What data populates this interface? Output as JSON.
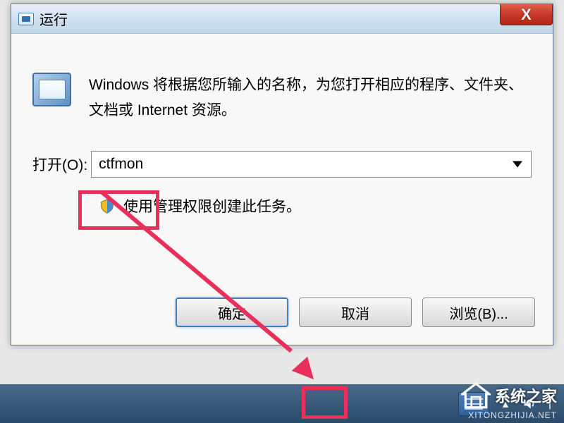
{
  "dialog": {
    "title": "运行",
    "description": "Windows 将根据您所输入的名称，为您打开相应的程序、文件夹、文档或 Internet 资源。",
    "open_label": "打开(O):",
    "input_value": "ctfmon",
    "admin_text": "使用管理权限创建此任务。",
    "buttons": {
      "ok": "确定",
      "cancel": "取消",
      "browse": "浏览(B)..."
    }
  },
  "watermark": {
    "brand": "系统之家",
    "url": "XITONGZHIJIA.NET"
  }
}
